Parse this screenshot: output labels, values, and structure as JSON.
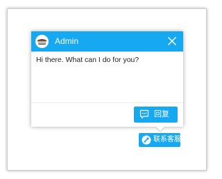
{
  "chat": {
    "agent_name": "Admin",
    "avatar_icon": "admin-avatar-icon",
    "close_icon": "close-icon",
    "message": "Hi there. What can I do for you?",
    "reply_label": "回复",
    "reply_icon": "chat-bubble-icon"
  },
  "launcher": {
    "label": "联系客服",
    "icon": "customer-service-icon"
  },
  "colors": {
    "accent": "#17a8f2",
    "text": "#222222",
    "background": "#ffffff"
  }
}
